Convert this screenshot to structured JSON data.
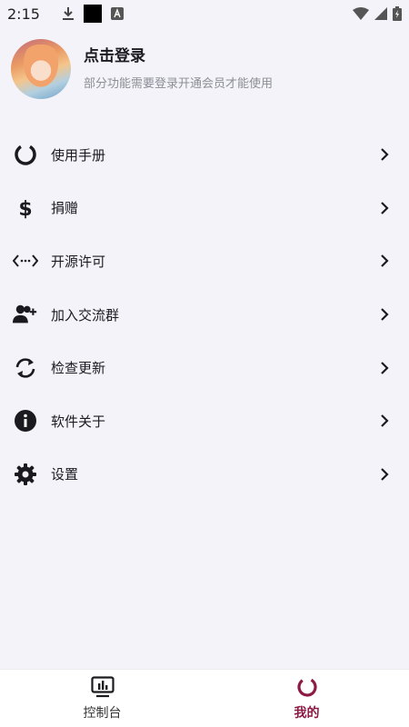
{
  "status_bar": {
    "time": "2:15"
  },
  "profile": {
    "title": "点击登录",
    "subtitle": "部分功能需要登录开通会员才能使用"
  },
  "menu": {
    "items": [
      {
        "label": "使用手册",
        "icon": "loading-ring-icon"
      },
      {
        "label": "捐赠",
        "icon": "dollar-icon"
      },
      {
        "label": "开源许可",
        "icon": "code-icon"
      },
      {
        "label": "加入交流群",
        "icon": "add-user-icon"
      },
      {
        "label": "检查更新",
        "icon": "sync-icon"
      },
      {
        "label": "软件关于",
        "icon": "info-icon"
      },
      {
        "label": "设置",
        "icon": "gear-icon"
      }
    ]
  },
  "bottom_nav": {
    "items": [
      {
        "label": "控制台",
        "icon": "monitor-icon",
        "active": false
      },
      {
        "label": "我的",
        "icon": "loading-ring-icon",
        "active": true
      }
    ]
  },
  "colors": {
    "background": "#f3f3f9",
    "accent": "#8c1a45",
    "text": "#1b1b1f",
    "subtext": "#8d8d96"
  }
}
